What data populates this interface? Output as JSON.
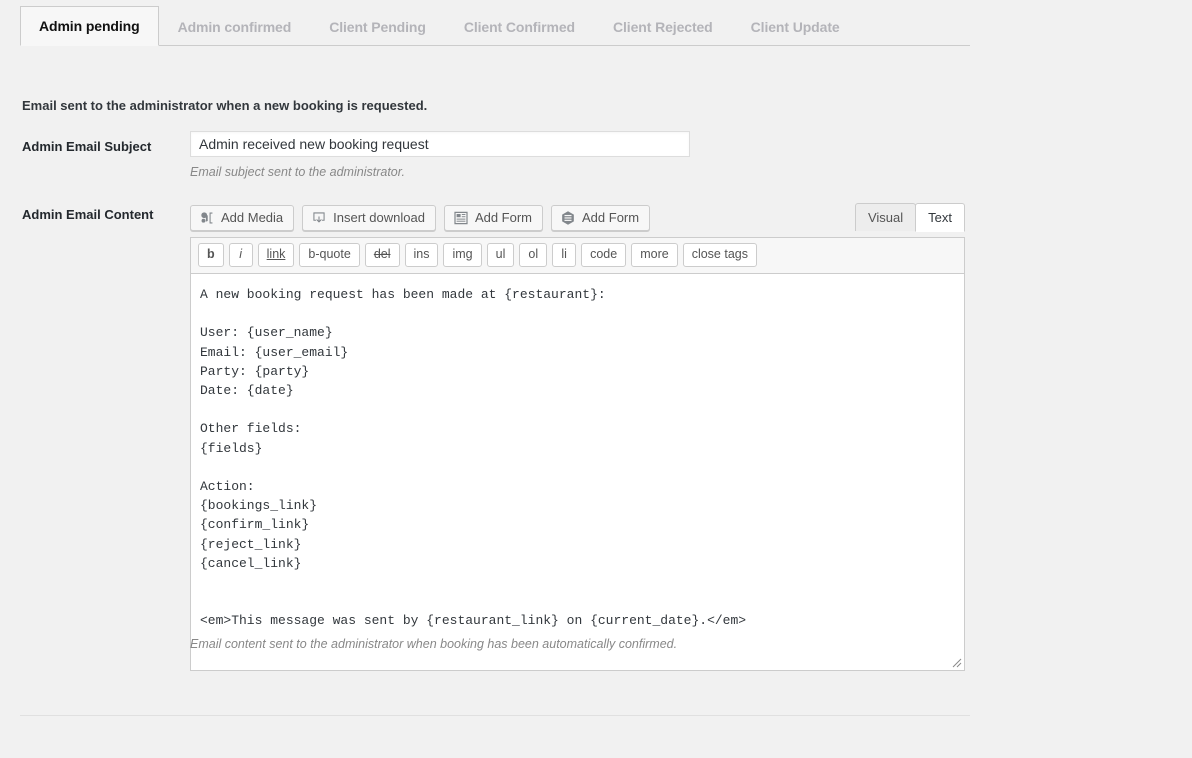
{
  "tabs": [
    {
      "label": "Admin pending",
      "active": true
    },
    {
      "label": "Admin confirmed",
      "active": false
    },
    {
      "label": "Client Pending",
      "active": false
    },
    {
      "label": "Client Confirmed",
      "active": false
    },
    {
      "label": "Client Rejected",
      "active": false
    },
    {
      "label": "Client Update",
      "active": false
    }
  ],
  "panel": {
    "intro": "Email sent to the administrator when a new booking is requested."
  },
  "subject_field": {
    "label": "Admin Email Subject",
    "value": "Admin received new booking request",
    "description": "Email subject sent to the administrator."
  },
  "content_field": {
    "label": "Admin Email Content",
    "description": "Email content sent to the administrator when booking has been automatically confirmed.",
    "value": "A new booking request has been made at {restaurant}:\n\nUser: {user_name}\nEmail: {user_email}\nParty: {party}\nDate: {date}\n\nOther fields:\n{fields}\n\nAction:\n{bookings_link}\n{confirm_link}\n{reject_link}\n{cancel_link}\n\n\n<em>This message was sent by {restaurant_link} on {current_date}.</em>"
  },
  "media_buttons": [
    {
      "label": "Add Media",
      "icon": "media-icon"
    },
    {
      "label": "Insert download",
      "icon": "download-icon"
    },
    {
      "label": "Add Form",
      "icon": "form-grid-icon"
    },
    {
      "label": "Add Form",
      "icon": "form-hex-icon"
    }
  ],
  "editor_modes": [
    {
      "label": "Visual",
      "active": false
    },
    {
      "label": "Text",
      "active": true
    }
  ],
  "quicktags": [
    {
      "label": "b",
      "style": "bold"
    },
    {
      "label": "i",
      "style": "italic"
    },
    {
      "label": "link",
      "style": "underline"
    },
    {
      "label": "b-quote",
      "style": "normal"
    },
    {
      "label": "del",
      "style": "strike"
    },
    {
      "label": "ins",
      "style": "normal"
    },
    {
      "label": "img",
      "style": "normal"
    },
    {
      "label": "ul",
      "style": "normal"
    },
    {
      "label": "ol",
      "style": "normal"
    },
    {
      "label": "li",
      "style": "normal"
    },
    {
      "label": "code",
      "style": "normal"
    },
    {
      "label": "more",
      "style": "normal"
    },
    {
      "label": "close tags",
      "style": "normal"
    }
  ],
  "colors": {
    "page_bg": "#f1f1f1",
    "active_tab_bg": "#f7f7f7",
    "inactive_tab_text": "#b4b4b9",
    "border": "#cccccc",
    "text": "#32373c",
    "muted": "#888888"
  }
}
